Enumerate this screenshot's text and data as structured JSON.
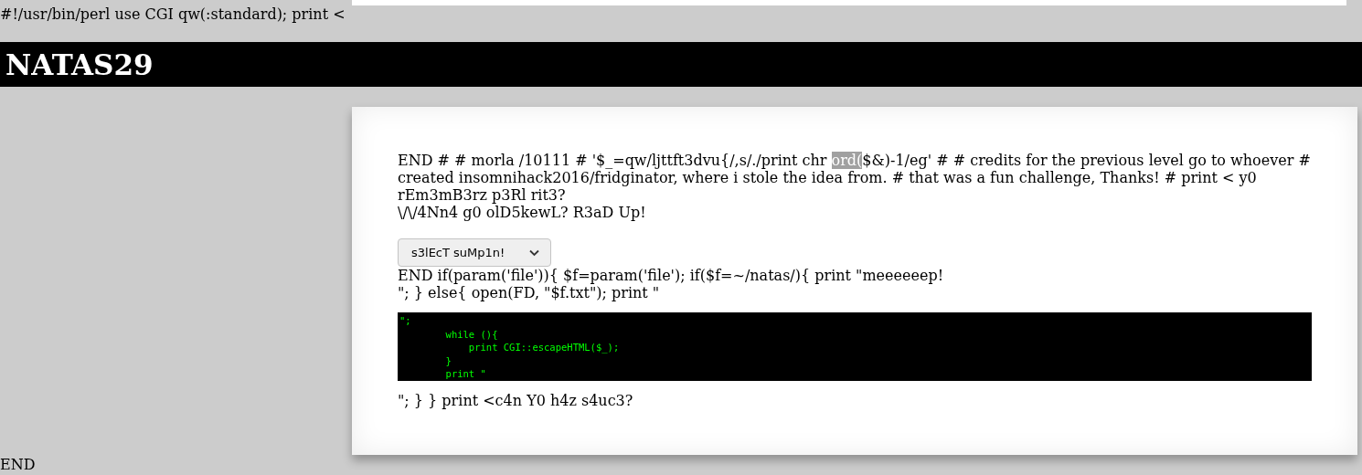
{
  "top_text": "#!/usr/bin/perl use CGI qw(:standard); print <",
  "banner": {
    "title": "NATAS29"
  },
  "card": {
    "intro_lines": [
      [
        {
          "text": "END # # morla /10111 # '$_=qw/ljttft3dvu{/,s/./print chr ",
          "selected": false
        },
        {
          "text": "ord(",
          "selected": true
        },
        {
          "text": "$&)-1/eg' # # credits for the previous level go to whoever #",
          "selected": false
        }
      ],
      [
        {
          "text": "created insomnihack2016/fridginator, where i stole the idea from. # that was a fun challenge, Thanks! # print < y0",
          "selected": false
        }
      ],
      [
        {
          "text": "rEm3mB3rz p3Rl rit3?",
          "selected": false
        }
      ],
      [
        {
          "text": "\\/\\/4Nn4 g0 olD5kewL? R3aD Up!",
          "selected": false
        }
      ]
    ],
    "select": {
      "value": "s3lEcT suMp1n!"
    },
    "middle_lines": [
      "END if(param('file')){ $f=param('file'); if($f=~/natas/){ print \"meeeeeep!",
      "\"; } else{ open(FD, \"$f.txt\"); print \""
    ],
    "code_lines": [
      "\";",
      "        while (){",
      "            print CGI::escapeHTML($_);",
      "        }",
      "        print \""
    ],
    "closing": "\"; } } print <c4n Y0 h4z s4uc3?"
  },
  "bottom_text": "END"
}
